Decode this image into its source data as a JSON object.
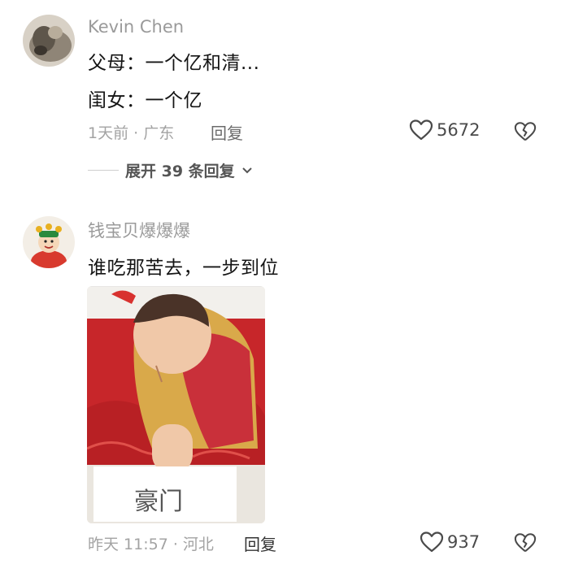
{
  "comments": [
    {
      "username": "Kevin Chen",
      "lines": [
        "父母：一个亿和清...",
        "闺女：一个亿"
      ],
      "meta": "1天前 · 广东",
      "reply_label": "回复",
      "likes": "5672",
      "expand_label": "展开 39 条回复"
    },
    {
      "username": "钱宝贝爆爆爆",
      "lines": [
        "谁吃那苦去，一步到位"
      ],
      "meta": "昨天 11:57 · 河北",
      "reply_label": "回复",
      "likes": "937",
      "image_text": "豪门"
    }
  ],
  "icons": {
    "like": "heart-outline-icon",
    "dislike": "broken-heart-icon",
    "expand": "chevron-down-icon"
  },
  "colors": {
    "username": "#9a9a9a",
    "meta": "#a3a3a3",
    "text": "#151515"
  }
}
